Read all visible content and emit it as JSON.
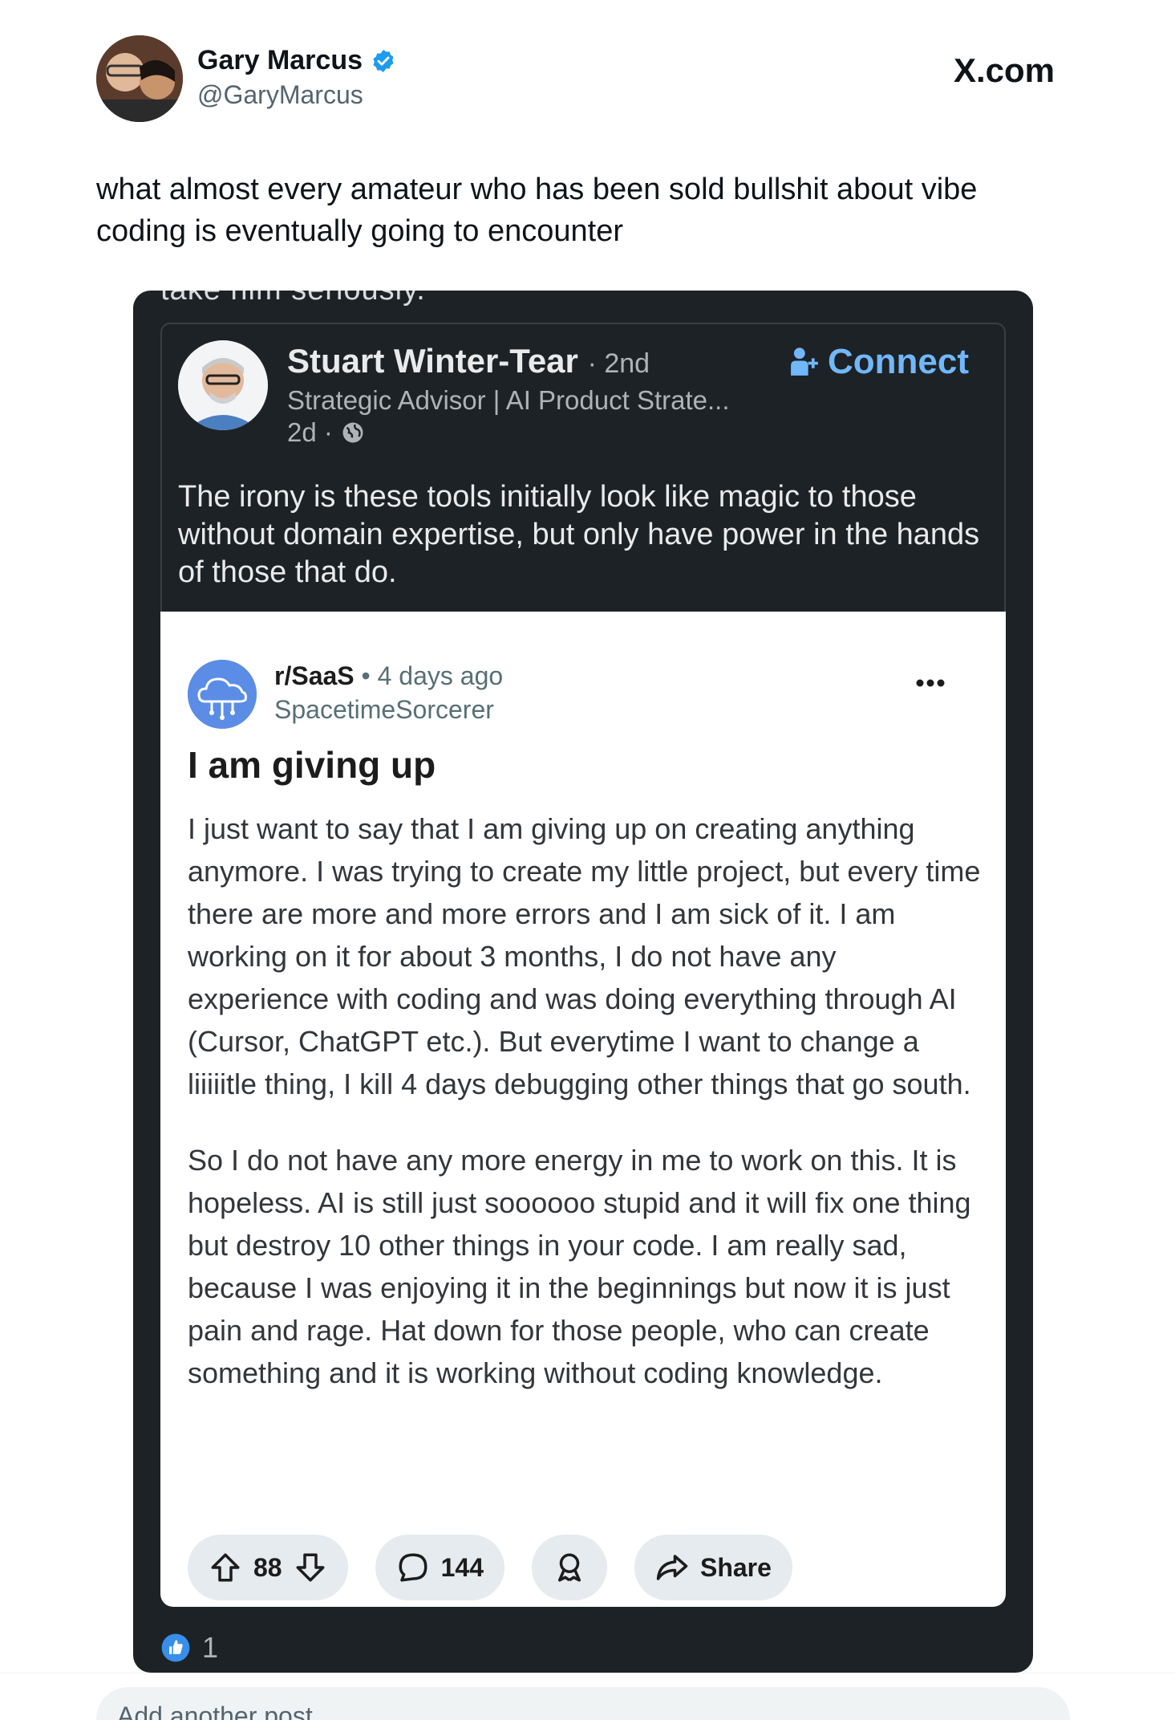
{
  "tweet": {
    "author_name": "Gary Marcus",
    "author_handle": "@GaryMarcus",
    "site": "X.com",
    "text": "what almost every amateur who has been sold bullshit about vibe coding is eventually going to encounter"
  },
  "linkedin_comment": {
    "cutoff_text": "take him seriously.",
    "name": "Stuart Winter-Tear",
    "degree": "· 2nd",
    "headline": "Strategic Advisor | AI Product Strate...",
    "time": "2d ·",
    "connect_label": "Connect",
    "text": "The irony is these tools initially look like magic to those without domain expertise, but only have power in the hands of those that do.",
    "reaction_count": "1"
  },
  "reddit_post": {
    "subreddit": "r/SaaS",
    "age": "• 4 days ago",
    "username": "SpacetimeSorcerer",
    "title": "I am giving up",
    "paragraphs": [
      "I just want to say that I am giving up on creating anything anymore. I was trying to create my little project, but every time there are more and more errors and I am sick of it. I am working on it for about 3 months, I do not have any experience with coding and was doing everything through AI (Cursor, ChatGPT etc.). But everytime I want to change a liiiiitle thing, I kill 4 days debugging other things that go south.",
      "So I do not have any more energy in me to work on this. It is hopeless. AI is still just soooooo stupid and it will fix one thing but destroy 10 other things in your code. I am really sad, because I was enjoying it in the beginnings but now it is just pain and rage. Hat down for those people, who can create something and it is working without coding knowledge."
    ],
    "votes": "88",
    "comments": "144",
    "share_label": "Share"
  },
  "composer": {
    "placeholder": "Add another post"
  },
  "colors": {
    "verified_blue": "#1d9bf0",
    "linkedin_link": "#71b7fb",
    "dark_card": "#1d2226",
    "reddit_pill": "#e5ebee"
  }
}
